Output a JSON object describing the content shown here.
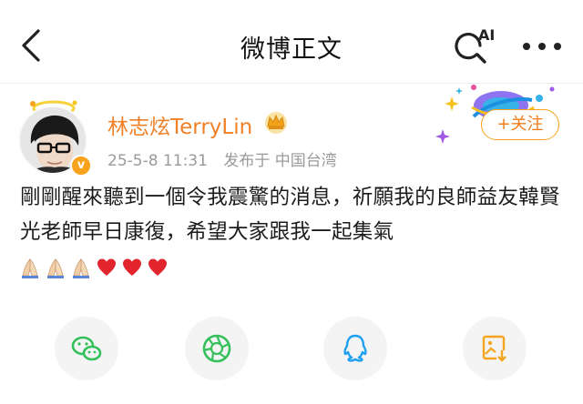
{
  "header": {
    "title": "微博正文",
    "ai_label": "AI"
  },
  "post": {
    "author": "林志炫TerryLin",
    "date": "25-5-8 11:31",
    "location": "发布于 中国台湾",
    "follow_label": "+关注",
    "verified_badge": "v",
    "text": "剛剛醒來聽到一個令我震驚的消息，祈願我的良師益友韓賢光老師早日康復，希望大家跟我一起集氣",
    "emojis": [
      "praying-hands",
      "praying-hands",
      "praying-hands",
      "red-heart",
      "red-heart",
      "red-heart"
    ]
  },
  "share": {
    "targets": [
      "wechat-icon",
      "moments-icon",
      "qq-icon",
      "save-image-icon"
    ]
  },
  "colors": {
    "username": "#f08026",
    "follow_border": "#f7a21a",
    "meta_text": "#9a9a9a",
    "wechat": "#34c05b",
    "moments": "#34c05b",
    "qq": "#1ea0f2",
    "save": "#f5a41f",
    "heart": "#e2242c"
  }
}
